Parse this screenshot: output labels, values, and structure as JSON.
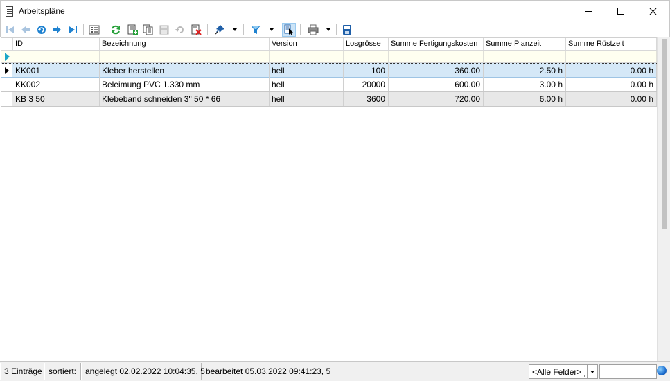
{
  "window": {
    "title": "Arbeitspläne",
    "minimize_label": "Minimize",
    "maximize_label": "Maximize",
    "close_label": "Close"
  },
  "toolbar": {
    "buttons": [
      {
        "name": "first-record",
        "icon": "skip-to-first-icon"
      },
      {
        "name": "previous-record",
        "icon": "arrow-left-icon"
      },
      {
        "name": "back-history",
        "icon": "undo-circle-icon"
      },
      {
        "name": "next-record",
        "icon": "arrow-right-icon"
      },
      {
        "name": "last-record",
        "icon": "skip-to-last-icon"
      },
      {
        "name": "list-view",
        "icon": "list-view-icon"
      },
      {
        "name": "refresh",
        "icon": "refresh-icon"
      },
      {
        "name": "new-record",
        "icon": "new-document-icon"
      },
      {
        "name": "copy-record",
        "icon": "copy-icon"
      },
      {
        "name": "save-record",
        "icon": "save-icon"
      },
      {
        "name": "undo",
        "icon": "undo-icon"
      },
      {
        "name": "delete-record",
        "icon": "delete-icon"
      },
      {
        "name": "pin",
        "icon": "pin-icon"
      },
      {
        "name": "filter",
        "icon": "filter-icon"
      },
      {
        "name": "selection-mode",
        "icon": "cursor-select-icon"
      },
      {
        "name": "print",
        "icon": "printer-icon"
      },
      {
        "name": "export",
        "icon": "floppy-blue-icon"
      }
    ]
  },
  "grid": {
    "columns": [
      "ID",
      "Bezeichnung",
      "Version",
      "Losgrösse",
      "Summe Fertigungskosten",
      "Summe Planzeit",
      "Summe Rüstzeit"
    ],
    "rows": [
      {
        "id": "KK001",
        "bezeichnung": "Kleber herstellen",
        "version": "hell",
        "losgroesse": "100",
        "fertigungskosten": "360.00",
        "planzeit": "2.50 h",
        "ruestzeit": "0.00 h"
      },
      {
        "id": "KK002",
        "bezeichnung": "Beleimung PVC 1.330 mm",
        "version": "hell",
        "losgroesse": "20000",
        "fertigungskosten": "600.00",
        "planzeit": "3.00 h",
        "ruestzeit": "0.00 h"
      },
      {
        "id": "KB 3 50",
        "bezeichnung": "Klebeband schneiden 3\" 50 * 66",
        "version": "hell",
        "losgroesse": "3600",
        "fertigungskosten": "720.00",
        "planzeit": "6.00 h",
        "ruestzeit": "0.00 h"
      }
    ]
  },
  "statusbar": {
    "count": "3 Einträge",
    "sorted": "sortiert:",
    "created": "angelegt 02.02.2022 10:04:35,  5",
    "edited": "bearbeitet 05.03.2022 09:41:23,  5",
    "field_select": "<Alle Felder>",
    "search_value": ""
  },
  "colors": {
    "selected_row": "#d5e8f7",
    "alt_row": "#e8e8e8",
    "filter_row": "#fffff0",
    "accent": "#1e6fd0"
  }
}
